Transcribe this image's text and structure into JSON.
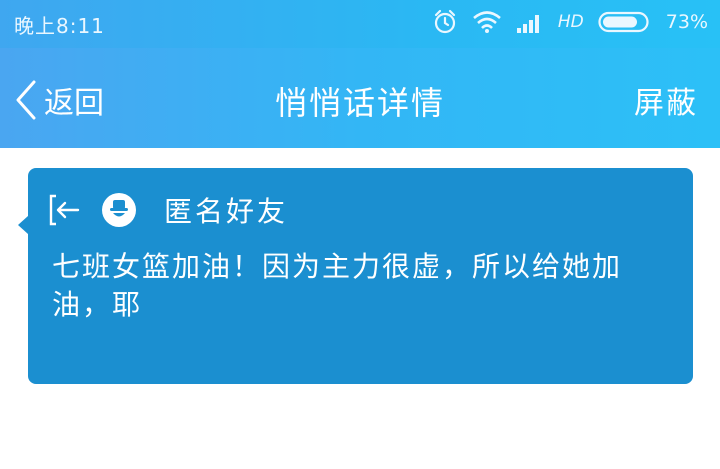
{
  "status_bar": {
    "time": "晚上8:11",
    "network": "HD",
    "battery": "73%",
    "icons": [
      "alarm-icon",
      "wifi-icon",
      "signal-icon",
      "battery-icon"
    ]
  },
  "nav": {
    "back_label": "返回",
    "title": "悄悄话详情",
    "block_label": "屏蔽"
  },
  "message_card": {
    "sender": "匿名好友",
    "text": "七班女篮加油！因为主力很虚，所以给她加油，耶",
    "icons": [
      "exit-icon",
      "anonymous-avatar-icon"
    ]
  },
  "colors": {
    "header_start": "#4aa6f1",
    "header_end": "#2cc0f7",
    "card_bg": "#1b8fd0",
    "text_on_blue": "#ffffff"
  }
}
